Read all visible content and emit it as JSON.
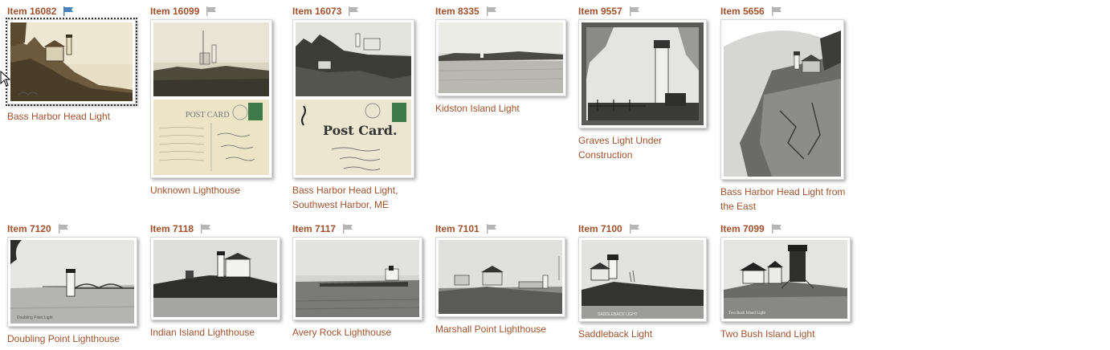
{
  "items": [
    {
      "id_label": "Item 16082",
      "title": "Bass Harbor Head Light",
      "flag": "flag-blue-icon",
      "flag_color": "#4a7fb5"
    },
    {
      "id_label": "Item 16099",
      "title": "Unknown Lighthouse",
      "flag": "flag-gray-icon",
      "flag_color": "#b5b5b5"
    },
    {
      "id_label": "Item 16073",
      "title": "Bass Harbor Head Light, Southwest Harbor, ME",
      "flag": "flag-gray-icon",
      "flag_color": "#b5b5b5"
    },
    {
      "id_label": "Item 8335",
      "title": "Kidston Island Light",
      "flag": "flag-gray-icon",
      "flag_color": "#b5b5b5"
    },
    {
      "id_label": "Item 9557",
      "title": "Graves Light Under Construction",
      "flag": "flag-gray-icon",
      "flag_color": "#b5b5b5"
    },
    {
      "id_label": "Item 5656",
      "title": "Bass Harbor Head Light from the East",
      "flag": "flag-gray-icon",
      "flag_color": "#b5b5b5"
    },
    {
      "id_label": "Item 7120",
      "title": "Doubling Point Lighthouse",
      "flag": "flag-gray-icon",
      "flag_color": "#b5b5b5"
    },
    {
      "id_label": "Item 7118",
      "title": "Indian Island Lighthouse",
      "flag": "flag-gray-icon",
      "flag_color": "#b5b5b5"
    },
    {
      "id_label": "Item 7117",
      "title": "Avery Rock Lighthouse",
      "flag": "flag-gray-icon",
      "flag_color": "#b5b5b5"
    },
    {
      "id_label": "Item 7101",
      "title": "Marshall Point Lighthouse",
      "flag": "flag-gray-icon",
      "flag_color": "#b5b5b5"
    },
    {
      "id_label": "Item 7100",
      "title": "Saddleback Light",
      "flag": "flag-gray-icon",
      "flag_color": "#b5b5b5"
    },
    {
      "id_label": "Item 7099",
      "title": "Two Bush Island Light",
      "flag": "flag-gray-icon",
      "flag_color": "#b5b5b5"
    }
  ],
  "colors": {
    "link": "#a0522d",
    "flag_active": "#4a7fb5",
    "flag_inactive": "#b5b5b5"
  }
}
